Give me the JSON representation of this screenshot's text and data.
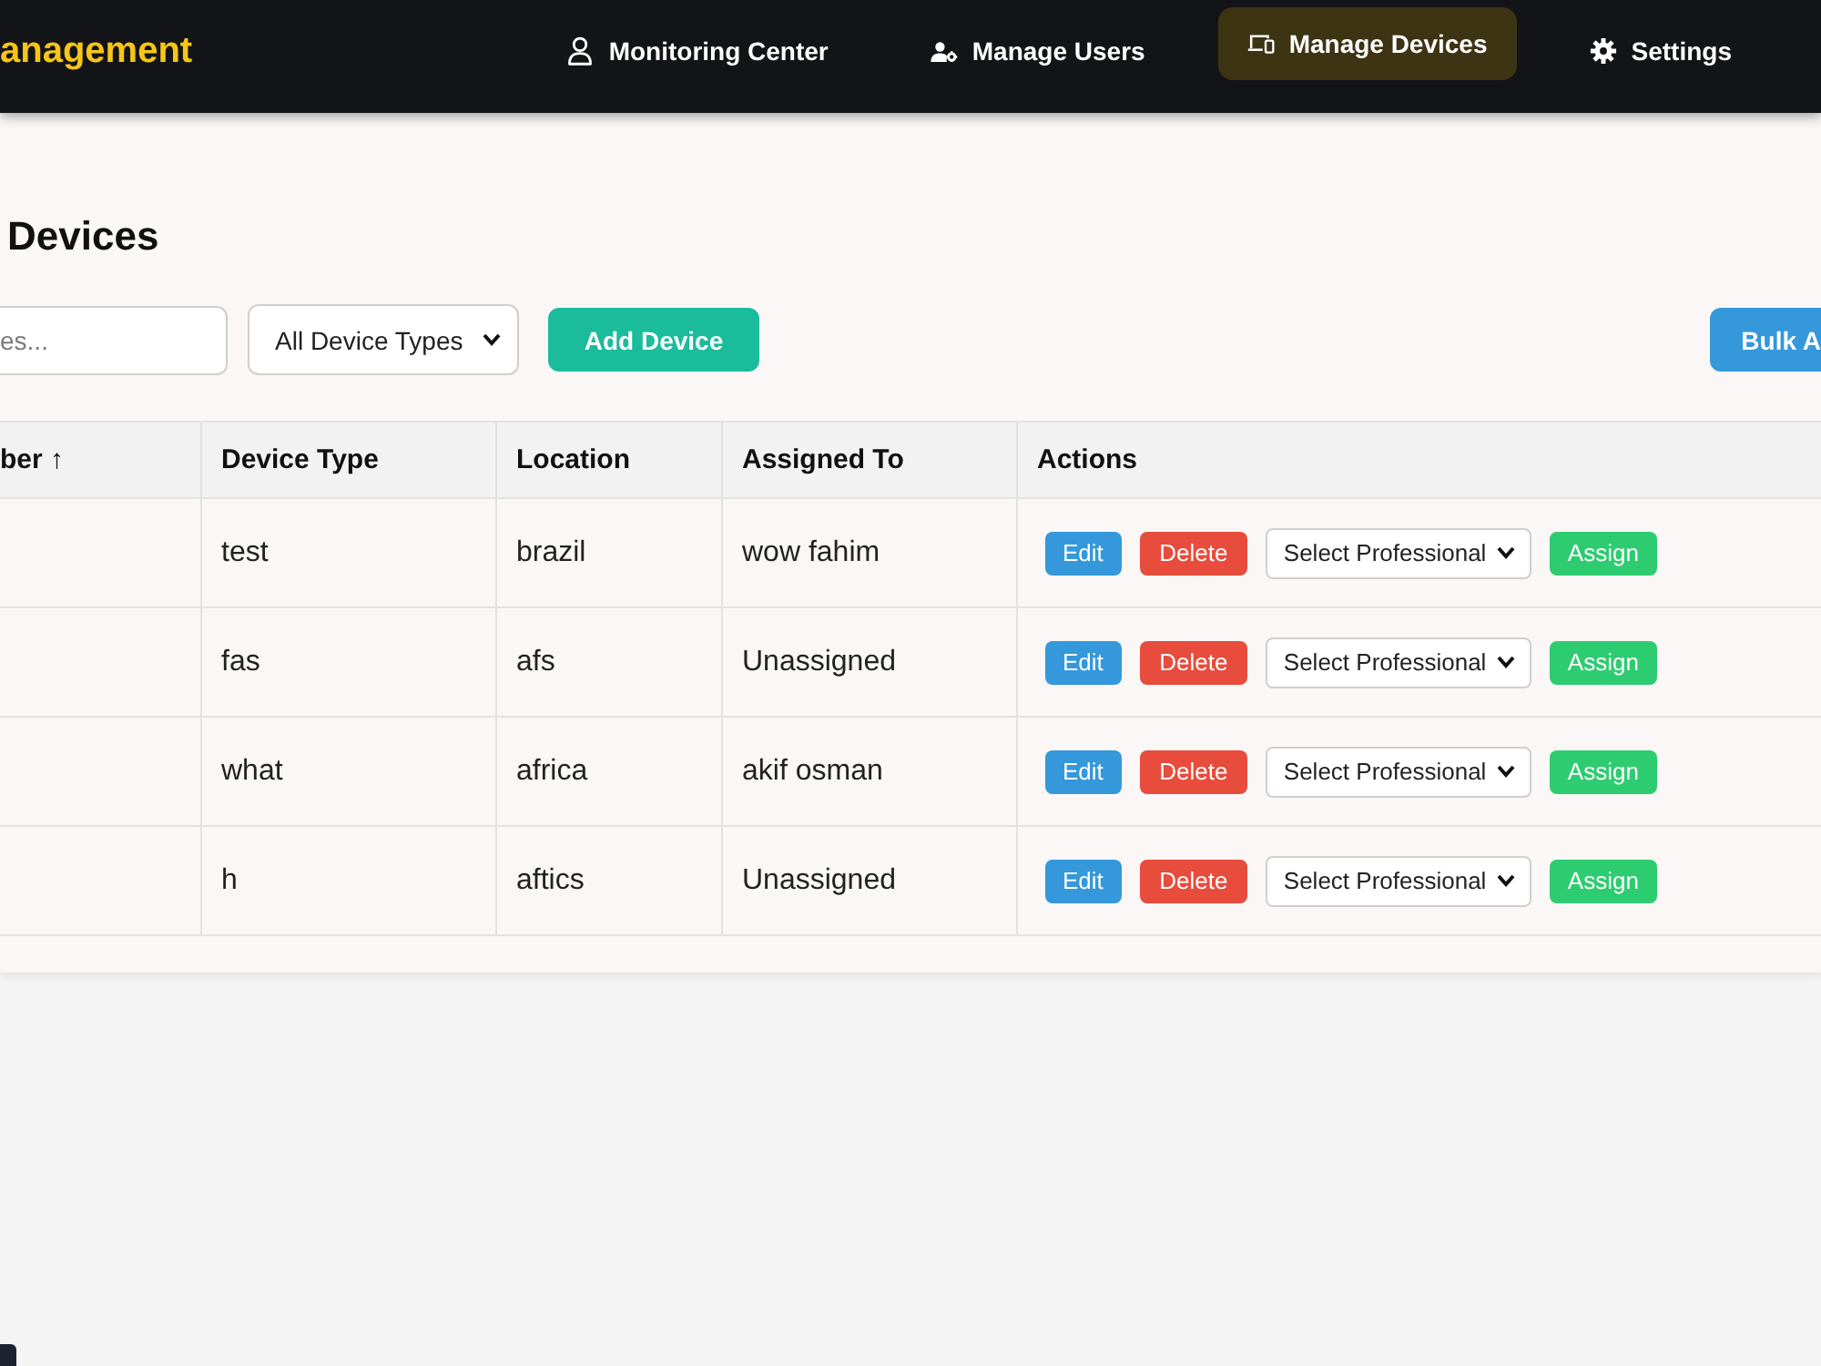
{
  "navbar": {
    "brand": "anagement",
    "items": [
      {
        "label": "Monitoring Center",
        "selected": false
      },
      {
        "label": "Manage Users",
        "selected": false
      },
      {
        "label": "Manage Devices",
        "selected": true
      },
      {
        "label": "Settings",
        "selected": false
      }
    ]
  },
  "page": {
    "title": "Devices",
    "search": {
      "placeholder": "es..."
    },
    "type_filter": {
      "value": "All Device Types"
    },
    "add_button": "Add Device",
    "bulk_button": "Bulk A"
  },
  "table": {
    "columns": [
      {
        "label": "ber ↑"
      },
      {
        "label": "Device Type"
      },
      {
        "label": "Location"
      },
      {
        "label": "Assigned To"
      },
      {
        "label": "Actions"
      }
    ],
    "rows": [
      {
        "device_type": "test",
        "location": "brazil",
        "assigned_to": "wow fahim",
        "actions": {
          "edit": "Edit",
          "delete": "Delete",
          "professional_select": {
            "value": "Select Professional"
          },
          "assign": "Assign"
        }
      },
      {
        "device_type": "fas",
        "location": "afs",
        "assigned_to": "Unassigned",
        "actions": {
          "edit": "Edit",
          "delete": "Delete",
          "professional_select": {
            "value": "Select Professional"
          },
          "assign": "Assign"
        }
      },
      {
        "device_type": "what",
        "location": "africa",
        "assigned_to": "akif osman",
        "actions": {
          "edit": "Edit",
          "delete": "Delete",
          "professional_select": {
            "value": "Select Professional"
          },
          "assign": "Assign"
        }
      },
      {
        "device_type": "h",
        "location": "aftics",
        "assigned_to": "Unassigned",
        "actions": {
          "edit": "Edit",
          "delete": "Delete",
          "professional_select": {
            "value": "Select Professional"
          },
          "assign": "Assign"
        }
      }
    ]
  }
}
